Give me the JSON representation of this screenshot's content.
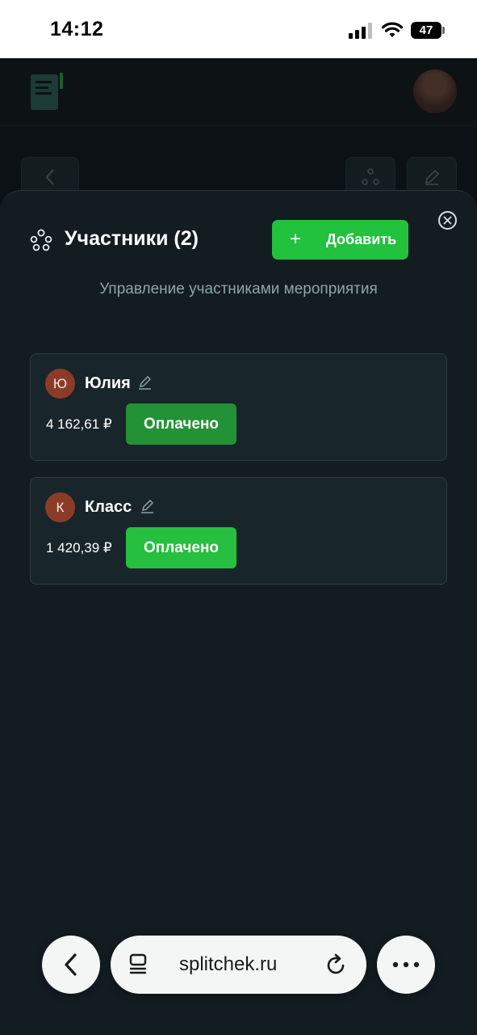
{
  "status_bar": {
    "time": "14:12",
    "battery": "47"
  },
  "modal": {
    "title": "Участники (2)",
    "add_button": "Добавить",
    "subtitle": "Управление участниками мероприятия"
  },
  "participants": [
    {
      "initial": "Ю",
      "name": "Юлия",
      "amount": "4 162,61 ₽",
      "status": "Оплачено",
      "status_color": "#239236"
    },
    {
      "initial": "К",
      "name": "Класс",
      "amount": "1 420,39 ₽",
      "status": "Оплачено",
      "status_color": "#26bf3f"
    }
  ],
  "browser": {
    "url": "splitchek.ru"
  },
  "colors": {
    "accent": "#22c13e",
    "sheet_bg": "#131c21",
    "card_bg": "#18252a",
    "avatar_bg": "#8a3c28"
  }
}
